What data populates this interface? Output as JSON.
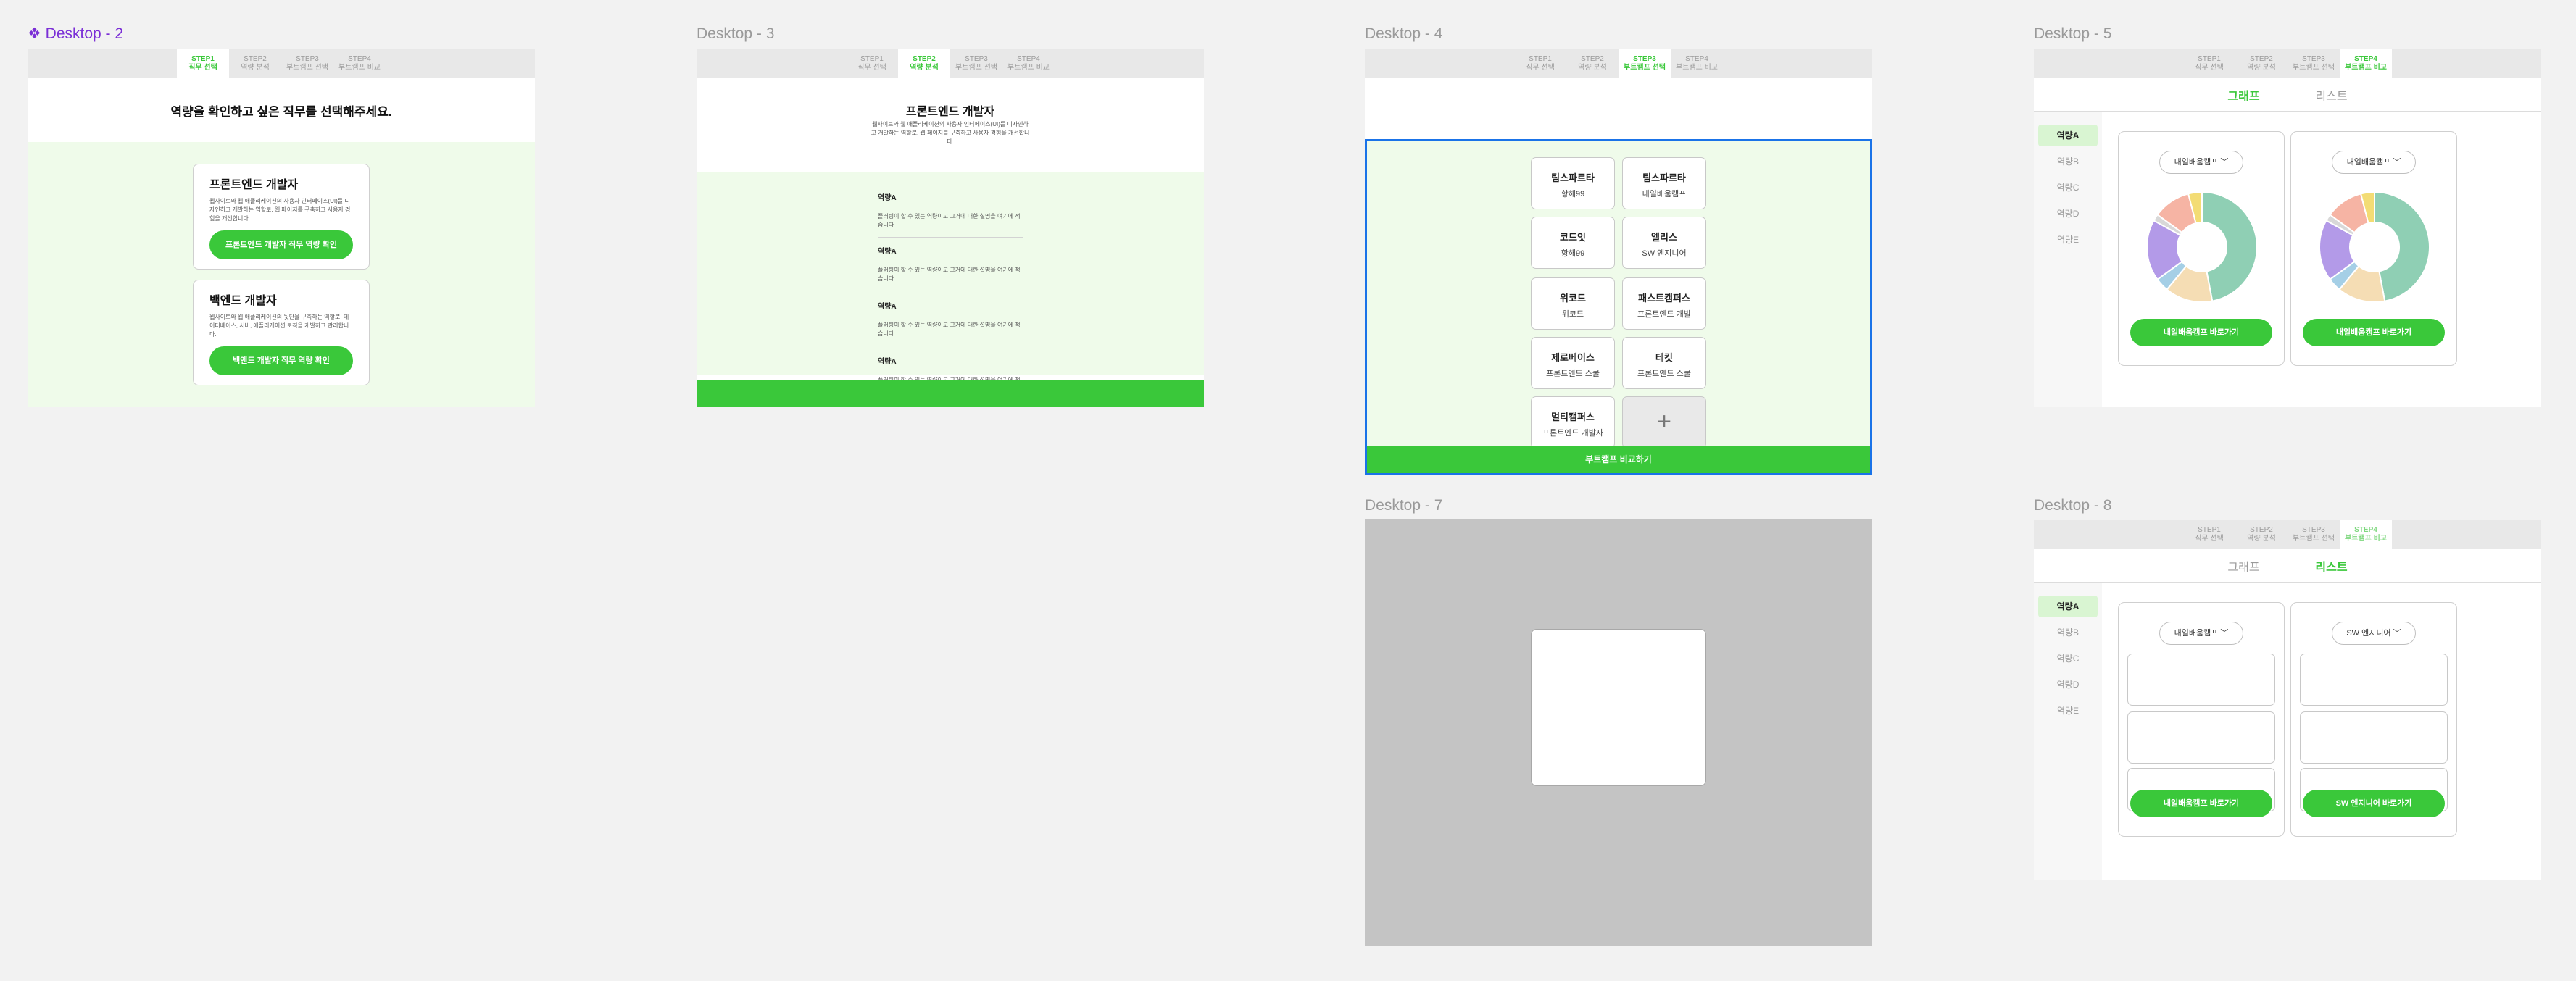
{
  "frames": {
    "d2": "Desktop - 2",
    "d3": "Desktop - 3",
    "d4": "Desktop - 4",
    "d5": "Desktop - 5",
    "d7": "Desktop - 7",
    "d8": "Desktop - 8"
  },
  "steps": [
    {
      "num": "STEP1",
      "label": "직무 선택"
    },
    {
      "num": "STEP2",
      "label": "역량 분석"
    },
    {
      "num": "STEP3",
      "label": "부트캠프 선택"
    },
    {
      "num": "STEP4",
      "label": "부트캠프 비교"
    }
  ],
  "d2": {
    "heading": "역량을 확인하고 싶은 직무를 선택해주세요.",
    "cards": [
      {
        "title": "프론트엔드 개발자",
        "desc": "웹사이트와 웹 애플리케이션의 사용자 인터페이스(UI)를 디자인하고 개발하는 역할로, 웹 페이지를 구축하고 사용자 경험을 개선합니다.",
        "button": "프론트엔드 개발자 직무 역량 확인"
      },
      {
        "title": "백엔드 개발자",
        "desc": "웹사이트와 웹 애플리케이션의 뒷단을 구축하는 역할로, 데이터베이스, 서버, 애플리케이션 로직을 개발하고 관리합니다.",
        "button": "백엔드 개발자 직무 역량 확인"
      }
    ]
  },
  "d3": {
    "title": "프론트엔드 개발자",
    "desc": "웹사이트와 웹 애플리케이션의 사용자 인터페이스(UI)를 디자인하고 개발하는 역할로, 웹 페이지를 구축하고 사용자 경험을 개선합니다.",
    "items": [
      {
        "title": "역량A",
        "desc": "플러팅이 할 수 있는 역량이고 그거에 대한 설명을 여기에 적습니다"
      },
      {
        "title": "역량A",
        "desc": "플러팅이 할 수 있는 역량이고 그거에 대한 설명을 여기에 적습니다"
      },
      {
        "title": "역량A",
        "desc": "플러팅이 할 수 있는 역량이고 그거에 대한 설명을 여기에 적습니다"
      },
      {
        "title": "역량A",
        "desc": "플러팅이 할 수 있는 역량이고 그거에 대한 설명을 여기에 적습니다"
      }
    ]
  },
  "d4": {
    "camps": [
      {
        "name": "팀스파르타",
        "course": "항해99"
      },
      {
        "name": "팀스파르타",
        "course": "내일배움캠프"
      },
      {
        "name": "코드잇",
        "course": "항해99"
      },
      {
        "name": "엘리스",
        "course": "SW 엔지니어"
      },
      {
        "name": "위코드",
        "course": "위코드"
      },
      {
        "name": "패스트캠퍼스",
        "course": "프론트엔드 개발"
      },
      {
        "name": "제로베이스",
        "course": "프론트엔드 스쿨"
      },
      {
        "name": "테킷",
        "course": "프론트엔드 스쿨"
      },
      {
        "name": "멀티캠퍼스",
        "course": "프론트엔드 개발자"
      }
    ],
    "add": "+",
    "compare_button": "부트캠프 비교하기"
  },
  "compare": {
    "tab_graph": "그래프",
    "tab_list": "리스트",
    "sidebar": [
      "역량A",
      "역량B",
      "역량C",
      "역량D",
      "역량E"
    ],
    "d5": [
      {
        "select": "내일배움캠프",
        "button": "내일배움캠프 바로가기"
      },
      {
        "select": "내일배움캠프",
        "button": "내일배움캠프 바로가기"
      }
    ],
    "d8": [
      {
        "select": "내일배움캠프",
        "button": "내일배움캠프 바로가기"
      },
      {
        "select": "SW 엔지니어",
        "button": "SW 엔지니어 바로가기"
      }
    ]
  },
  "colors": {
    "accent": "#3ac83a",
    "light_green": "#effbea",
    "selection": "#1a73e8",
    "overlay": "#c4c4c4"
  },
  "donut_slices": [
    {
      "value": 47,
      "color": "#8fcfb4"
    },
    {
      "value": 14,
      "color": "#f5ddb4"
    },
    {
      "value": 4,
      "color": "#a5cfe6"
    },
    {
      "value": 18,
      "color": "#b39ae8"
    },
    {
      "value": 2,
      "color": "#d8d8d8"
    },
    {
      "value": 11,
      "color": "#f6b4a4"
    },
    {
      "value": 4,
      "color": "#f3dc74"
    }
  ]
}
